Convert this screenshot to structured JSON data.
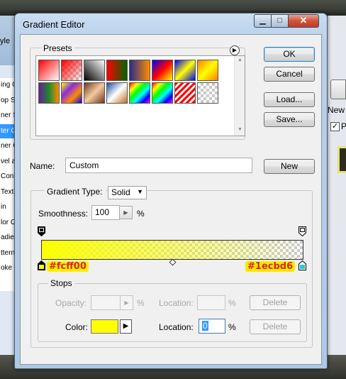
{
  "window": {
    "title": "Gradient Editor",
    "min_icon": "minimize-icon",
    "max_icon": "maximize-icon",
    "close_icon": "close-icon"
  },
  "background_left": {
    "title_fragment": "yle",
    "items": [
      {
        "label": "ing Op",
        "selected": false
      },
      {
        "label": "op Sh",
        "selected": false
      },
      {
        "label": "ner Sh",
        "selected": false
      },
      {
        "label": "ter Gl",
        "selected": true
      },
      {
        "label": "ner Gl",
        "selected": false
      },
      {
        "label": "vel an",
        "selected": false
      },
      {
        "label": "Conto",
        "selected": false
      },
      {
        "label": "Textu",
        "selected": false
      },
      {
        "label": "in",
        "selected": false
      },
      {
        "label": "lor O",
        "selected": false
      },
      {
        "label": "adient",
        "selected": false
      },
      {
        "label": "ttern O",
        "selected": false
      },
      {
        "label": "oke",
        "selected": false
      }
    ]
  },
  "background_right": {
    "new_fragment": "New",
    "preview_fragment": "P",
    "preview_checked": true
  },
  "presets": {
    "label": "Presets",
    "menu_icon": "play-arrow-icon",
    "swatches": [
      {
        "name": "fg-to-bg",
        "fill": "linear-gradient(135deg,#ff0000 0%,#ffffff 100%)"
      },
      {
        "name": "fg-to-transparent",
        "fill": "checker-red"
      },
      {
        "name": "black-white",
        "fill": "linear-gradient(45deg,#000 0%,#fff 100%)"
      },
      {
        "name": "red-green",
        "fill": "linear-gradient(90deg,#ff0000,#006600)"
      },
      {
        "name": "violet-orange",
        "fill": "linear-gradient(90deg,#2a2a8c,#ff8c00)"
      },
      {
        "name": "blue-red-yellow",
        "fill": "linear-gradient(135deg,#0000ff,#ff0000,#ffff00)"
      },
      {
        "name": "blue-yellow-blue",
        "fill": "linear-gradient(135deg,#0000ff,#ffff00,#0000ff)"
      },
      {
        "name": "orange-yellow-orange",
        "fill": "linear-gradient(135deg,#ff8000,#ffff00,#ff8000)"
      },
      {
        "name": "violet-green-orange",
        "fill": "linear-gradient(90deg,#6a1b9a,#1b8a2a,#ff8c00)"
      },
      {
        "name": "yellow-violet-orange-blue",
        "fill": "linear-gradient(135deg,#ffff00,#8a2be2,#ff8c00,#0000ff)"
      },
      {
        "name": "copper",
        "fill": "linear-gradient(135deg,#6b3a1f,#f5c9a0,#6b3a1f)"
      },
      {
        "name": "chrome",
        "fill": "linear-gradient(135deg,#1f4ea0,#ffffff,#c07020)"
      },
      {
        "name": "spectrum",
        "fill": "linear-gradient(135deg,#ff0000,#ffff00,#00ff00,#00ffff,#0000ff,#ff00ff)"
      },
      {
        "name": "transparent-rainbow",
        "fill": "linear-gradient(135deg,#ff0000,#ffff00,#00ff00,#00ffff,#0000ff,#ff00ff)"
      },
      {
        "name": "transparent-stripes",
        "fill": "repeating-linear-gradient(135deg,#ff0000 0 3px,#ffffff 3px 6px)"
      },
      {
        "name": "checker-empty",
        "fill": "checker"
      }
    ]
  },
  "buttons": {
    "ok": "OK",
    "cancel": "Cancel",
    "load": "Load...",
    "save": "Save...",
    "new": "New",
    "delete_opacity": "Delete",
    "delete_color": "Delete"
  },
  "name": {
    "label": "Name:",
    "value": "Custom"
  },
  "gradient": {
    "type_label": "Gradient Type:",
    "type_value": "Solid",
    "smoothness_label": "Smoothness:",
    "smoothness_value": "100",
    "percent": "%",
    "left_color": "#fcff00",
    "right_color": "#1ecbd6",
    "left_hex_label": "#fcff00",
    "right_hex_label": "#1ecbd6"
  },
  "stops": {
    "label": "Stops",
    "opacity_label": "Opacity:",
    "opacity_pct": "%",
    "opacity_location_label": "Location:",
    "opacity_location_pct": "%",
    "color_label": "Color:",
    "color_value": "#ffff00",
    "color_location_label": "Location:",
    "color_location_value": "0",
    "color_location_pct": "%"
  }
}
